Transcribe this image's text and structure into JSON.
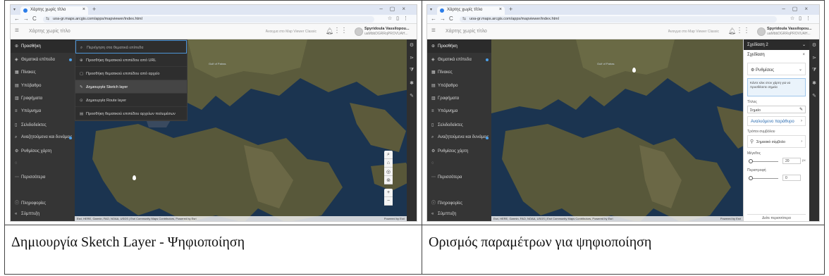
{
  "browser": {
    "tab_title": "Χάρτης χωρίς τίτλο",
    "url": "uoa-gr.maps.arcgis.com/apps/mapviewer/index.html"
  },
  "app": {
    "title": "Χάρτης χωρίς τίτλο",
    "classic_link": "Άνοιγμα στο Map Viewer Classic",
    "user_name": "Spyridoula Vassilopou...",
    "user_org": "uaMbbDGRRqPROVUAH..."
  },
  "nav": [
    {
      "icon": "⊕",
      "label": "Προσθήκη"
    },
    {
      "icon": "◈",
      "label": "Θεματικά επίπεδα"
    },
    {
      "icon": "▦",
      "label": "Πίνακες"
    },
    {
      "icon": "▤",
      "label": "Υπόβαθρο"
    },
    {
      "icon": "▥",
      "label": "Γραφήματα"
    },
    {
      "icon": "≡",
      "label": "Υπόμνημα"
    },
    {
      "icon": "▯",
      "label": "Σελιδοδείκτες"
    },
    {
      "icon": "⌕",
      "label": "Αναζητούμενα και δυνάμεις"
    },
    {
      "icon": "⚙",
      "label": "Ρυθμίσεις χάρτη"
    },
    {
      "icon": "◌",
      "label": ""
    },
    {
      "icon": "⋯",
      "label": "Περισσότερα"
    }
  ],
  "nav_bottom": [
    {
      "icon": "ⓘ",
      "label": "Πληροφορίες"
    },
    {
      "icon": "«",
      "label": "Σύμπτυξη"
    }
  ],
  "add_menu": [
    {
      "icon": "⌕",
      "label": "Περιήγηση στα θεματικά επίπεδα"
    },
    {
      "icon": "⊕",
      "label": "Προσθήκη θεματικού επιπέδου από URL"
    },
    {
      "icon": "▢",
      "label": "Προσθήκη θεματικού επιπέδου από αρχείο"
    },
    {
      "icon": "✎",
      "label": "Δημιουργία Sketch layer"
    },
    {
      "icon": "⊙",
      "label": "Δημιουργία Route layer"
    },
    {
      "icon": "▤",
      "label": "Προσθήκη θεματικού επιπέδου αρχείων πολυμέσων"
    }
  ],
  "map_labels": {
    "gulf": "Gulf of Patras",
    "attribution": "Esri, HERE, Garmin, FAO, NOAA, USGS | Esri Community Maps Contributors, Powered by Esri",
    "powered": "Powered by Esri"
  },
  "sketch_panel": {
    "header": "Σχεδίαση 2",
    "title": "Σχεδίαση",
    "settings": "Ρυθμίσεις",
    "note": "Κάντε κλικ στον χάρτη για να προσθέσετε σημεία",
    "name_label": "Τίτλος",
    "name_value": "Σημείο",
    "pattern": "Αναλυόμενο παράθυρο",
    "symbol_label": "Τρόποι συμβόλου",
    "symbol_value": "Σημειακό σύμβολο",
    "size_label": "Μέγεθος",
    "size_value": "20",
    "size_unit": "px",
    "rotation_label": "Περιστροφή",
    "rotation_value": "0",
    "footer": "Δείτε περισσότερα"
  },
  "captions": {
    "left": "Δημιουργία Sketch Layer - Ψηφιοποίηση",
    "right": "Ορισμός παραμέτρων για ψηφιοποίηση"
  },
  "colors": {
    "nav_bg": "#353535",
    "accent": "#4c9fe8",
    "sea": "#1b3450"
  }
}
